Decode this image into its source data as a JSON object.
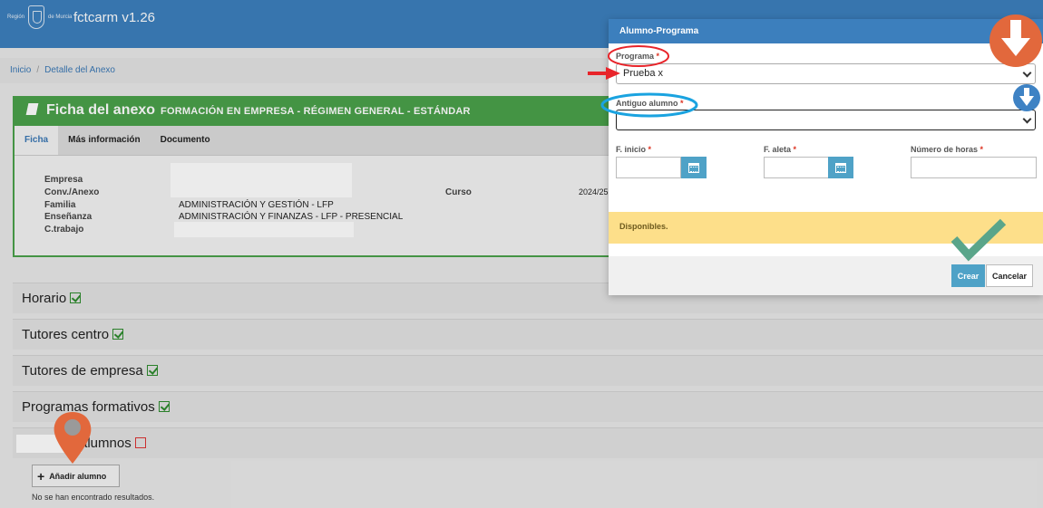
{
  "app": {
    "logo_text_left": "Región",
    "logo_text_right": "de Murcia",
    "title": "fctcarm v1.26"
  },
  "breadcrumb": {
    "home": "Inicio",
    "sep": "/",
    "current": "Detalle del Anexo"
  },
  "ficha": {
    "title": "Ficha del anexo",
    "subtitle": "FORMACIÓN EN EMPRESA - RÉGIMEN GENERAL - ESTÁNDAR",
    "tabs": [
      "Ficha",
      "Más información",
      "Documento"
    ],
    "fields": {
      "empresa_label": "Empresa",
      "conv_label": "Conv./Anexo",
      "familia_label": "Familia",
      "familia_value": "ADMINISTRACIÓN Y GESTIÓN - LFP",
      "ensenanza_label": "Enseñanza",
      "ensenanza_value": "ADMINISTRACIÓN Y FINANZAS - LFP - PRESENCIAL",
      "ctrabajo_label": "C.trabajo",
      "curso_label": "Curso",
      "curso_value": "2024/25"
    }
  },
  "sections": {
    "horario": "Horario",
    "tutores_centro": "Tutores centro",
    "tutores_empresa": "Tutores de empresa",
    "programas": "Programas formativos",
    "alumnos": "alumnos"
  },
  "alumnos": {
    "add_button": "Añadir alumno",
    "add_icon": "plus-icon",
    "no_results": "No se han encontrado resultados."
  },
  "modal": {
    "title": "Alumno-Programa",
    "programa_label": "Programa",
    "programa_value": "Prueba x",
    "antiguo_label": "Antiguo alumno",
    "antiguo_value": "",
    "inicio_label": "F. inicio",
    "aleta_label": "F. aleta",
    "horas_label": "Número de horas",
    "required_mark": "*",
    "notice": "Disponibles.",
    "create_button": "Crear",
    "cancel_button": "Cancelar"
  },
  "colors": {
    "topbar": "#3c7fbd",
    "ficha_green": "#4aa14a",
    "notice_yellow": "#fddf8a",
    "button_blue": "#4fa2c7",
    "annotation_orange": "#e2683c",
    "annotation_red": "#e8242a",
    "annotation_cyan": "#1aa3e0",
    "annotation_blue": "#3e82c4",
    "annotation_teal": "#5aa58a"
  }
}
